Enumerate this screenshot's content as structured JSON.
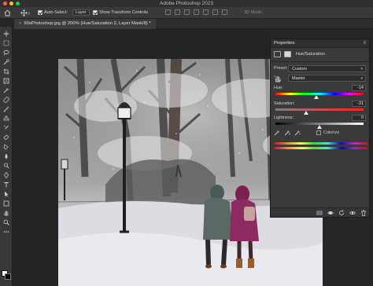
{
  "window": {
    "app_title": "Adobe Photoshop 2023"
  },
  "options_bar": {
    "auto_select_label": "Auto-Select:",
    "auto_select_target": "Layer",
    "show_transform_label": "Show Transform Controls",
    "mode_3d_label": "3D Mode:"
  },
  "document": {
    "tab_label": "90sPhotoshop.jpg @ 200% (Hue/Saturation 2, Layer Mask/8) *",
    "close_glyph": "×"
  },
  "properties": {
    "title": "Properties",
    "menu_glyph": "≡",
    "layer_label": "Hue/Saturation",
    "preset_label": "Preset:",
    "preset_value": "Custom",
    "channel_value": "Master",
    "hue_label": "Hue:",
    "hue_value": "-14",
    "saturation_label": "Saturation:",
    "saturation_value": "-31",
    "lightness_label": "Lightness:",
    "lightness_value": "0",
    "colorize_label": "Colorize",
    "hue_min": -180,
    "hue_max": 180,
    "sat_min": -100,
    "sat_max": 100,
    "light_min": -100,
    "light_max": 100
  },
  "icons": {
    "home": "home-icon",
    "move": "move-icon",
    "hand": "hand-icon",
    "eyedropper": "eyedropper-icon"
  }
}
